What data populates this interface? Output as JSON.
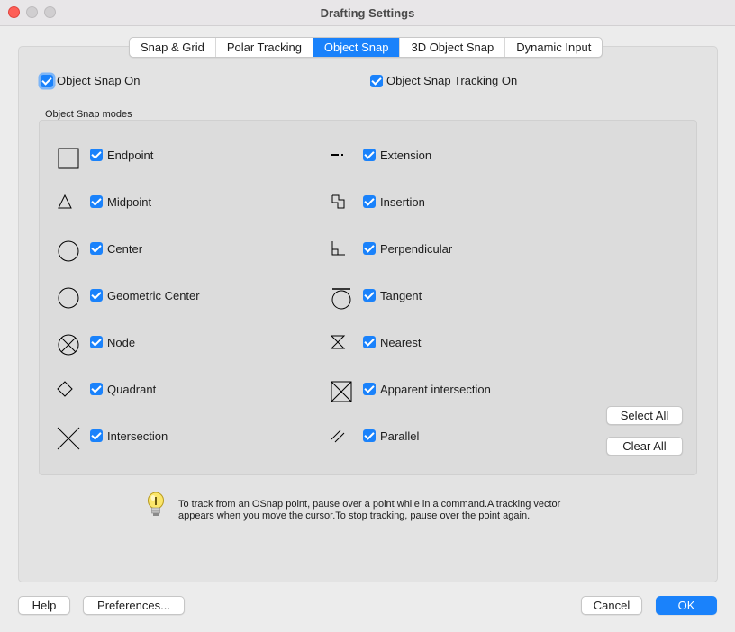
{
  "window": {
    "title": "Drafting Settings"
  },
  "tabs": [
    {
      "label": "Snap & Grid",
      "active": false
    },
    {
      "label": "Polar Tracking",
      "active": false
    },
    {
      "label": "Object Snap",
      "active": true
    },
    {
      "label": "3D Object Snap",
      "active": false
    },
    {
      "label": "Dynamic Input",
      "active": false
    }
  ],
  "options": {
    "object_snap_on": {
      "label": "Object Snap On",
      "checked": true
    },
    "object_snap_tracking_on": {
      "label": "Object Snap Tracking On",
      "checked": true
    }
  },
  "modes_section": {
    "title": "Object Snap modes",
    "left": [
      {
        "label": "Endpoint",
        "icon": "endpoint-square-icon",
        "checked": true
      },
      {
        "label": "Midpoint",
        "icon": "midpoint-triangle-icon",
        "checked": true
      },
      {
        "label": "Center",
        "icon": "center-circle-icon",
        "checked": true
      },
      {
        "label": "Geometric Center",
        "icon": "geometric-center-circle-icon",
        "checked": true
      },
      {
        "label": "Node",
        "icon": "node-circle-x-icon",
        "checked": true
      },
      {
        "label": "Quadrant",
        "icon": "quadrant-diamond-icon",
        "checked": true
      },
      {
        "label": "Intersection",
        "icon": "intersection-x-icon",
        "checked": true
      }
    ],
    "right": [
      {
        "label": "Extension",
        "icon": "extension-dash-icon",
        "checked": true
      },
      {
        "label": "Insertion",
        "icon": "insertion-squares-icon",
        "checked": true
      },
      {
        "label": "Perpendicular",
        "icon": "perpendicular-icon",
        "checked": true
      },
      {
        "label": "Tangent",
        "icon": "tangent-icon",
        "checked": true
      },
      {
        "label": "Nearest",
        "icon": "nearest-hourglass-icon",
        "checked": true
      },
      {
        "label": "Apparent intersection",
        "icon": "apparent-intersection-icon",
        "checked": true
      },
      {
        "label": "Parallel",
        "icon": "parallel-lines-icon",
        "checked": true
      }
    ],
    "select_all_label": "Select All",
    "clear_all_label": "Clear All"
  },
  "hint": {
    "icon": "lightbulb-icon",
    "line1": "To track from an OSnap point, pause over a point while in a command.A tracking vector",
    "line2": "appears when you move the cursor.To stop tracking, pause over the point again."
  },
  "footer": {
    "help_label": "Help",
    "preferences_label": "Preferences...",
    "cancel_label": "Cancel",
    "ok_label": "OK"
  },
  "colors": {
    "accent": "#1a82fb",
    "close": "#fe5f57"
  }
}
